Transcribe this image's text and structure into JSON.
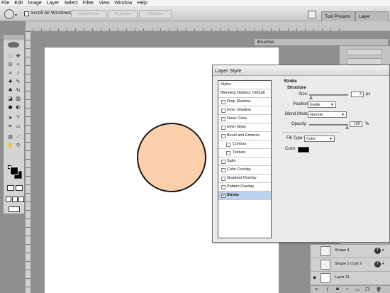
{
  "menu": [
    "File",
    "Edit",
    "Image",
    "Layer",
    "Select",
    "Filter",
    "View",
    "Window",
    "Help"
  ],
  "options": {
    "scroll_all_windows": "Scroll All Windows",
    "buttons": [
      "Actual Pixels",
      "Fit Screen",
      "Print Size"
    ]
  },
  "panel_tabs": [
    "Tool Presets",
    "Layer Comps"
  ],
  "brushes_tab": "Brushes",
  "dialog": {
    "title": "Layer Style",
    "styles_header": "Styles",
    "blending": "Blending Options: Default",
    "effects": [
      "Drop Shadow",
      "Inner Shadow",
      "Outer Glow",
      "Inner Glow",
      "Bevel and Emboss",
      "Contour",
      "Texture",
      "Satin",
      "Color Overlay",
      "Gradient Overlay",
      "Pattern Overlay",
      "Stroke"
    ],
    "stroke": {
      "section": "Stroke",
      "structure": "Structure",
      "size_label": "Size:",
      "size_value": "3",
      "size_unit": "px",
      "position_label": "Position:",
      "position_value": "Inside",
      "blend_label": "Blend Mode:",
      "blend_value": "Normal",
      "opacity_label": "Opacity:",
      "opacity_value": "100",
      "opacity_unit": "%",
      "fill_label": "Fill Type:",
      "fill_value": "Color",
      "color_label": "Color:",
      "color_hex": "#000000"
    }
  },
  "layers": [
    {
      "name": "Shape 4"
    },
    {
      "name": "Shape 1 copy 2"
    },
    {
      "name": "Layer 11"
    }
  ],
  "colors": {
    "circle_fill": "#fcd0aa",
    "stroke": "#000000"
  }
}
